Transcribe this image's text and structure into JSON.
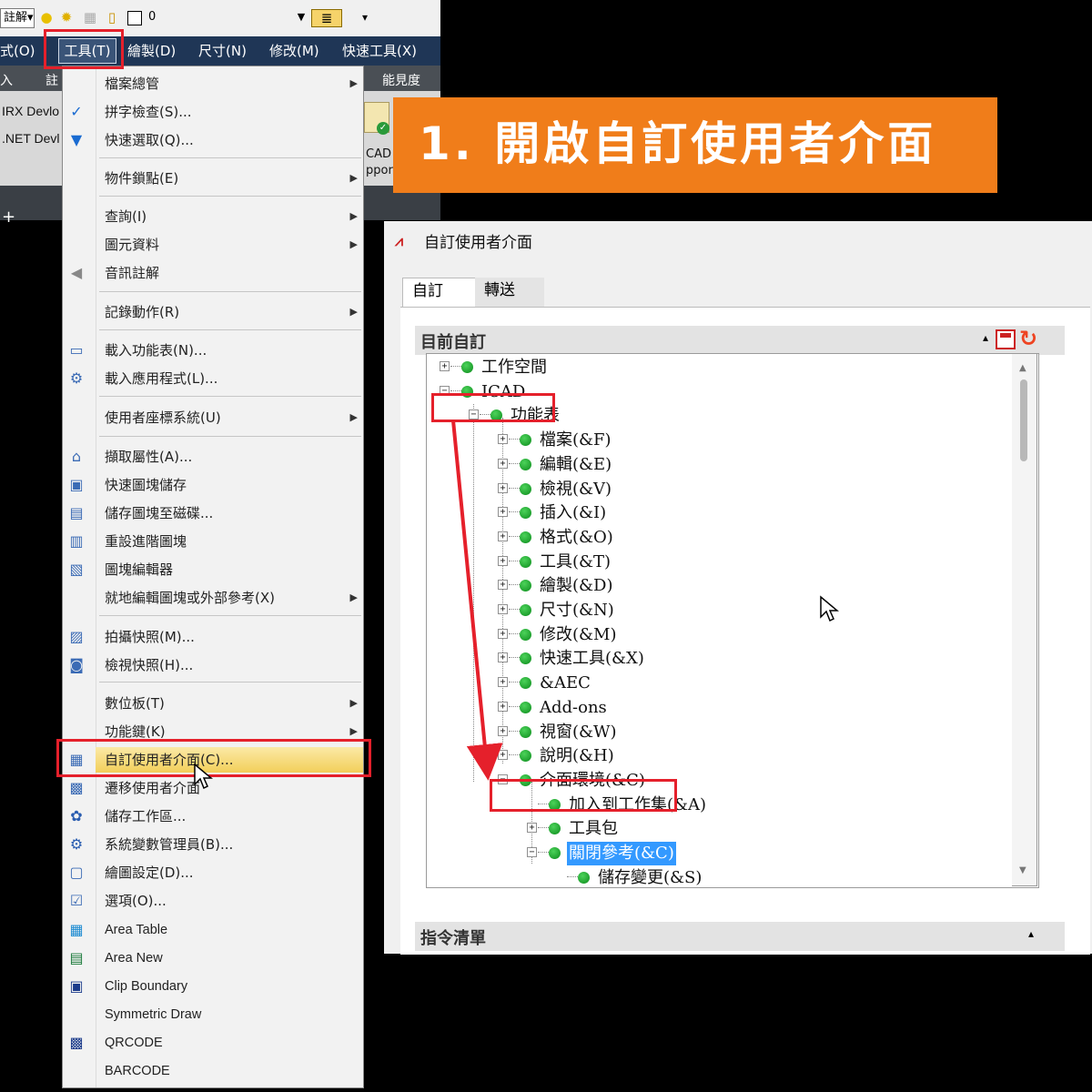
{
  "toolbar": {
    "combo_left": "註解",
    "layer_value": "0",
    "overflow": "▾"
  },
  "menubar": {
    "items": [
      "式(O)",
      "工具(T)",
      "繪製(D)",
      "尺寸(N)",
      "修改(M)",
      "快速工具(X)"
    ]
  },
  "ribbon": {
    "t1": "入",
    "t2": "註",
    "t3": "能見度",
    "t4": "IRX Devlo",
    "t5": ".NET Devl",
    "t6": "CAD",
    "t7": "ppor",
    "t8": "+"
  },
  "menu": {
    "items": [
      {
        "label": "檔案總管",
        "icon": "",
        "sub": true
      },
      {
        "label": "拼字檢查(S)...",
        "icon": "spellcheck-icon",
        "sub": false
      },
      {
        "label": "快速選取(Q)...",
        "icon": "filter-icon",
        "sub": false
      },
      {
        "label": "物件鎖點(E)",
        "icon": "",
        "sub": true
      },
      {
        "label": "查詢(I)",
        "icon": "",
        "sub": true
      },
      {
        "label": "圖元資料",
        "icon": "",
        "sub": true
      },
      {
        "label": "音訊註解",
        "icon": "speaker-icon",
        "sub": false
      },
      {
        "label": "記錄動作(R)",
        "icon": "",
        "sub": true
      },
      {
        "label": "載入功能表(N)...",
        "icon": "load-menu-icon",
        "sub": false
      },
      {
        "label": "載入應用程式(L)...",
        "icon": "load-app-icon",
        "sub": false
      },
      {
        "label": "使用者座標系統(U)",
        "icon": "",
        "sub": true
      },
      {
        "label": "擷取屬性(A)...",
        "icon": "extract-attr-icon",
        "sub": false
      },
      {
        "label": "快速圖塊儲存",
        "icon": "block-save-icon",
        "sub": false
      },
      {
        "label": "儲存圖塊至磁碟...",
        "icon": "block-disk-icon",
        "sub": false
      },
      {
        "label": "重設進階圖塊",
        "icon": "block-reset-icon",
        "sub": false
      },
      {
        "label": "圖塊編輯器",
        "icon": "block-editor-icon",
        "sub": false
      },
      {
        "label": "就地編輯圖塊或外部參考(X)",
        "icon": "",
        "sub": true
      },
      {
        "label": "拍攝快照(M)...",
        "icon": "snapshot-icon",
        "sub": false
      },
      {
        "label": "檢視快照(H)...",
        "icon": "camera-icon",
        "sub": false
      },
      {
        "label": "數位板(T)",
        "icon": "",
        "sub": true
      },
      {
        "label": "功能鍵(K)",
        "icon": "",
        "sub": true
      },
      {
        "label": "自訂使用者介面(C)...",
        "icon": "customize-ui-icon",
        "sub": false
      },
      {
        "label": "遷移使用者介面",
        "icon": "migrate-ui-icon",
        "sub": false
      },
      {
        "label": "儲存工作區...",
        "icon": "workspace-save-icon",
        "sub": false
      },
      {
        "label": "系統變數管理員(B)...",
        "icon": "gear-icon",
        "sub": false
      },
      {
        "label": "繪圖設定(D)...",
        "icon": "draw-settings-icon",
        "sub": false
      },
      {
        "label": "選項(O)...",
        "icon": "options-icon",
        "sub": false
      },
      {
        "label": "Area Table",
        "icon": "area-table-icon",
        "sub": false
      },
      {
        "label": "Area New",
        "icon": "area-new-icon",
        "sub": false
      },
      {
        "label": "Clip Boundary",
        "icon": "clip-boundary-icon",
        "sub": false
      },
      {
        "label": "Symmetric Draw",
        "icon": "",
        "sub": false
      },
      {
        "label": "QRCODE",
        "icon": "qrcode-icon",
        "sub": false
      },
      {
        "label": "BARCODE",
        "icon": "",
        "sub": false
      }
    ]
  },
  "banner": {
    "text": "1. 開啟自訂使用者介面"
  },
  "dialog": {
    "title": "自訂使用者介面",
    "tabs": [
      "自訂",
      "轉送"
    ],
    "section1": "目前自訂",
    "section2": "指令清單",
    "tree": [
      {
        "label": "工作空間",
        "expander": "+"
      },
      {
        "label": "ICAD",
        "expander": "−"
      },
      {
        "label": "功能表",
        "expander": "−"
      },
      {
        "label": "檔案(&F)",
        "expander": "+"
      },
      {
        "label": "編輯(&E)",
        "expander": "+"
      },
      {
        "label": "檢視(&V)",
        "expander": "+"
      },
      {
        "label": "插入(&I)",
        "expander": "+"
      },
      {
        "label": "格式(&O)",
        "expander": "+"
      },
      {
        "label": "工具(&T)",
        "expander": "+"
      },
      {
        "label": "繪製(&D)",
        "expander": "+"
      },
      {
        "label": "尺寸(&N)",
        "expander": "+"
      },
      {
        "label": "修改(&M)",
        "expander": "+"
      },
      {
        "label": "快速工具(&X)",
        "expander": "+"
      },
      {
        "label": "&AEC",
        "expander": "+"
      },
      {
        "label": "Add-ons",
        "expander": "+"
      },
      {
        "label": "視窗(&W)",
        "expander": "+"
      },
      {
        "label": "說明(&H)",
        "expander": "+"
      },
      {
        "label": "介面環境(&C)",
        "expander": "−"
      },
      {
        "label": "加入到工作集(&A)",
        "expander": ""
      },
      {
        "label": "工具包",
        "expander": "+"
      },
      {
        "label": "關閉參考(&C)",
        "expander": "−"
      },
      {
        "label": "儲存變更(&S)",
        "expander": ""
      }
    ]
  },
  "colors": {
    "accent": "#f07d1a",
    "highlight_box": "#e5202b",
    "menubar": "#1f3656",
    "selection": "#3399ff"
  }
}
